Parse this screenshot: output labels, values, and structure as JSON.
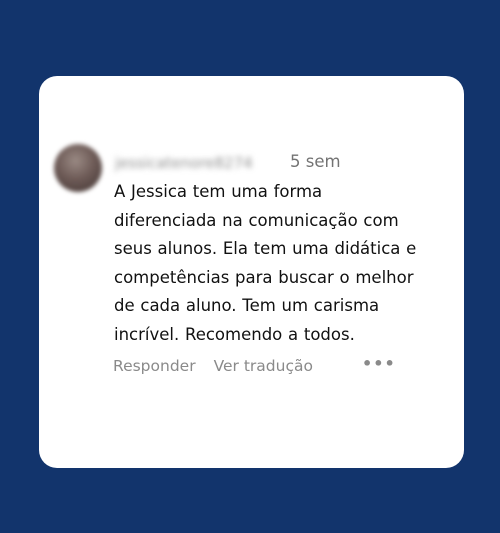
{
  "comment": {
    "author": "jessicatenore8274",
    "timestamp": "5 sem",
    "lines": [
      "A Jessica tem uma forma",
      "diferenciada na comunicação com",
      "seus alunos. Ela tem uma didática e",
      "competências para buscar o melhor",
      "de cada aluno. Tem um carisma",
      "incrível. Recomendo a todos."
    ],
    "actions": {
      "reply": "Responder",
      "translate": "Ver tradução",
      "more": "•••"
    }
  },
  "colors": {
    "background": "#12346c",
    "card": "#ffffff",
    "text": "#111111",
    "muted": "#8a8a8a"
  }
}
